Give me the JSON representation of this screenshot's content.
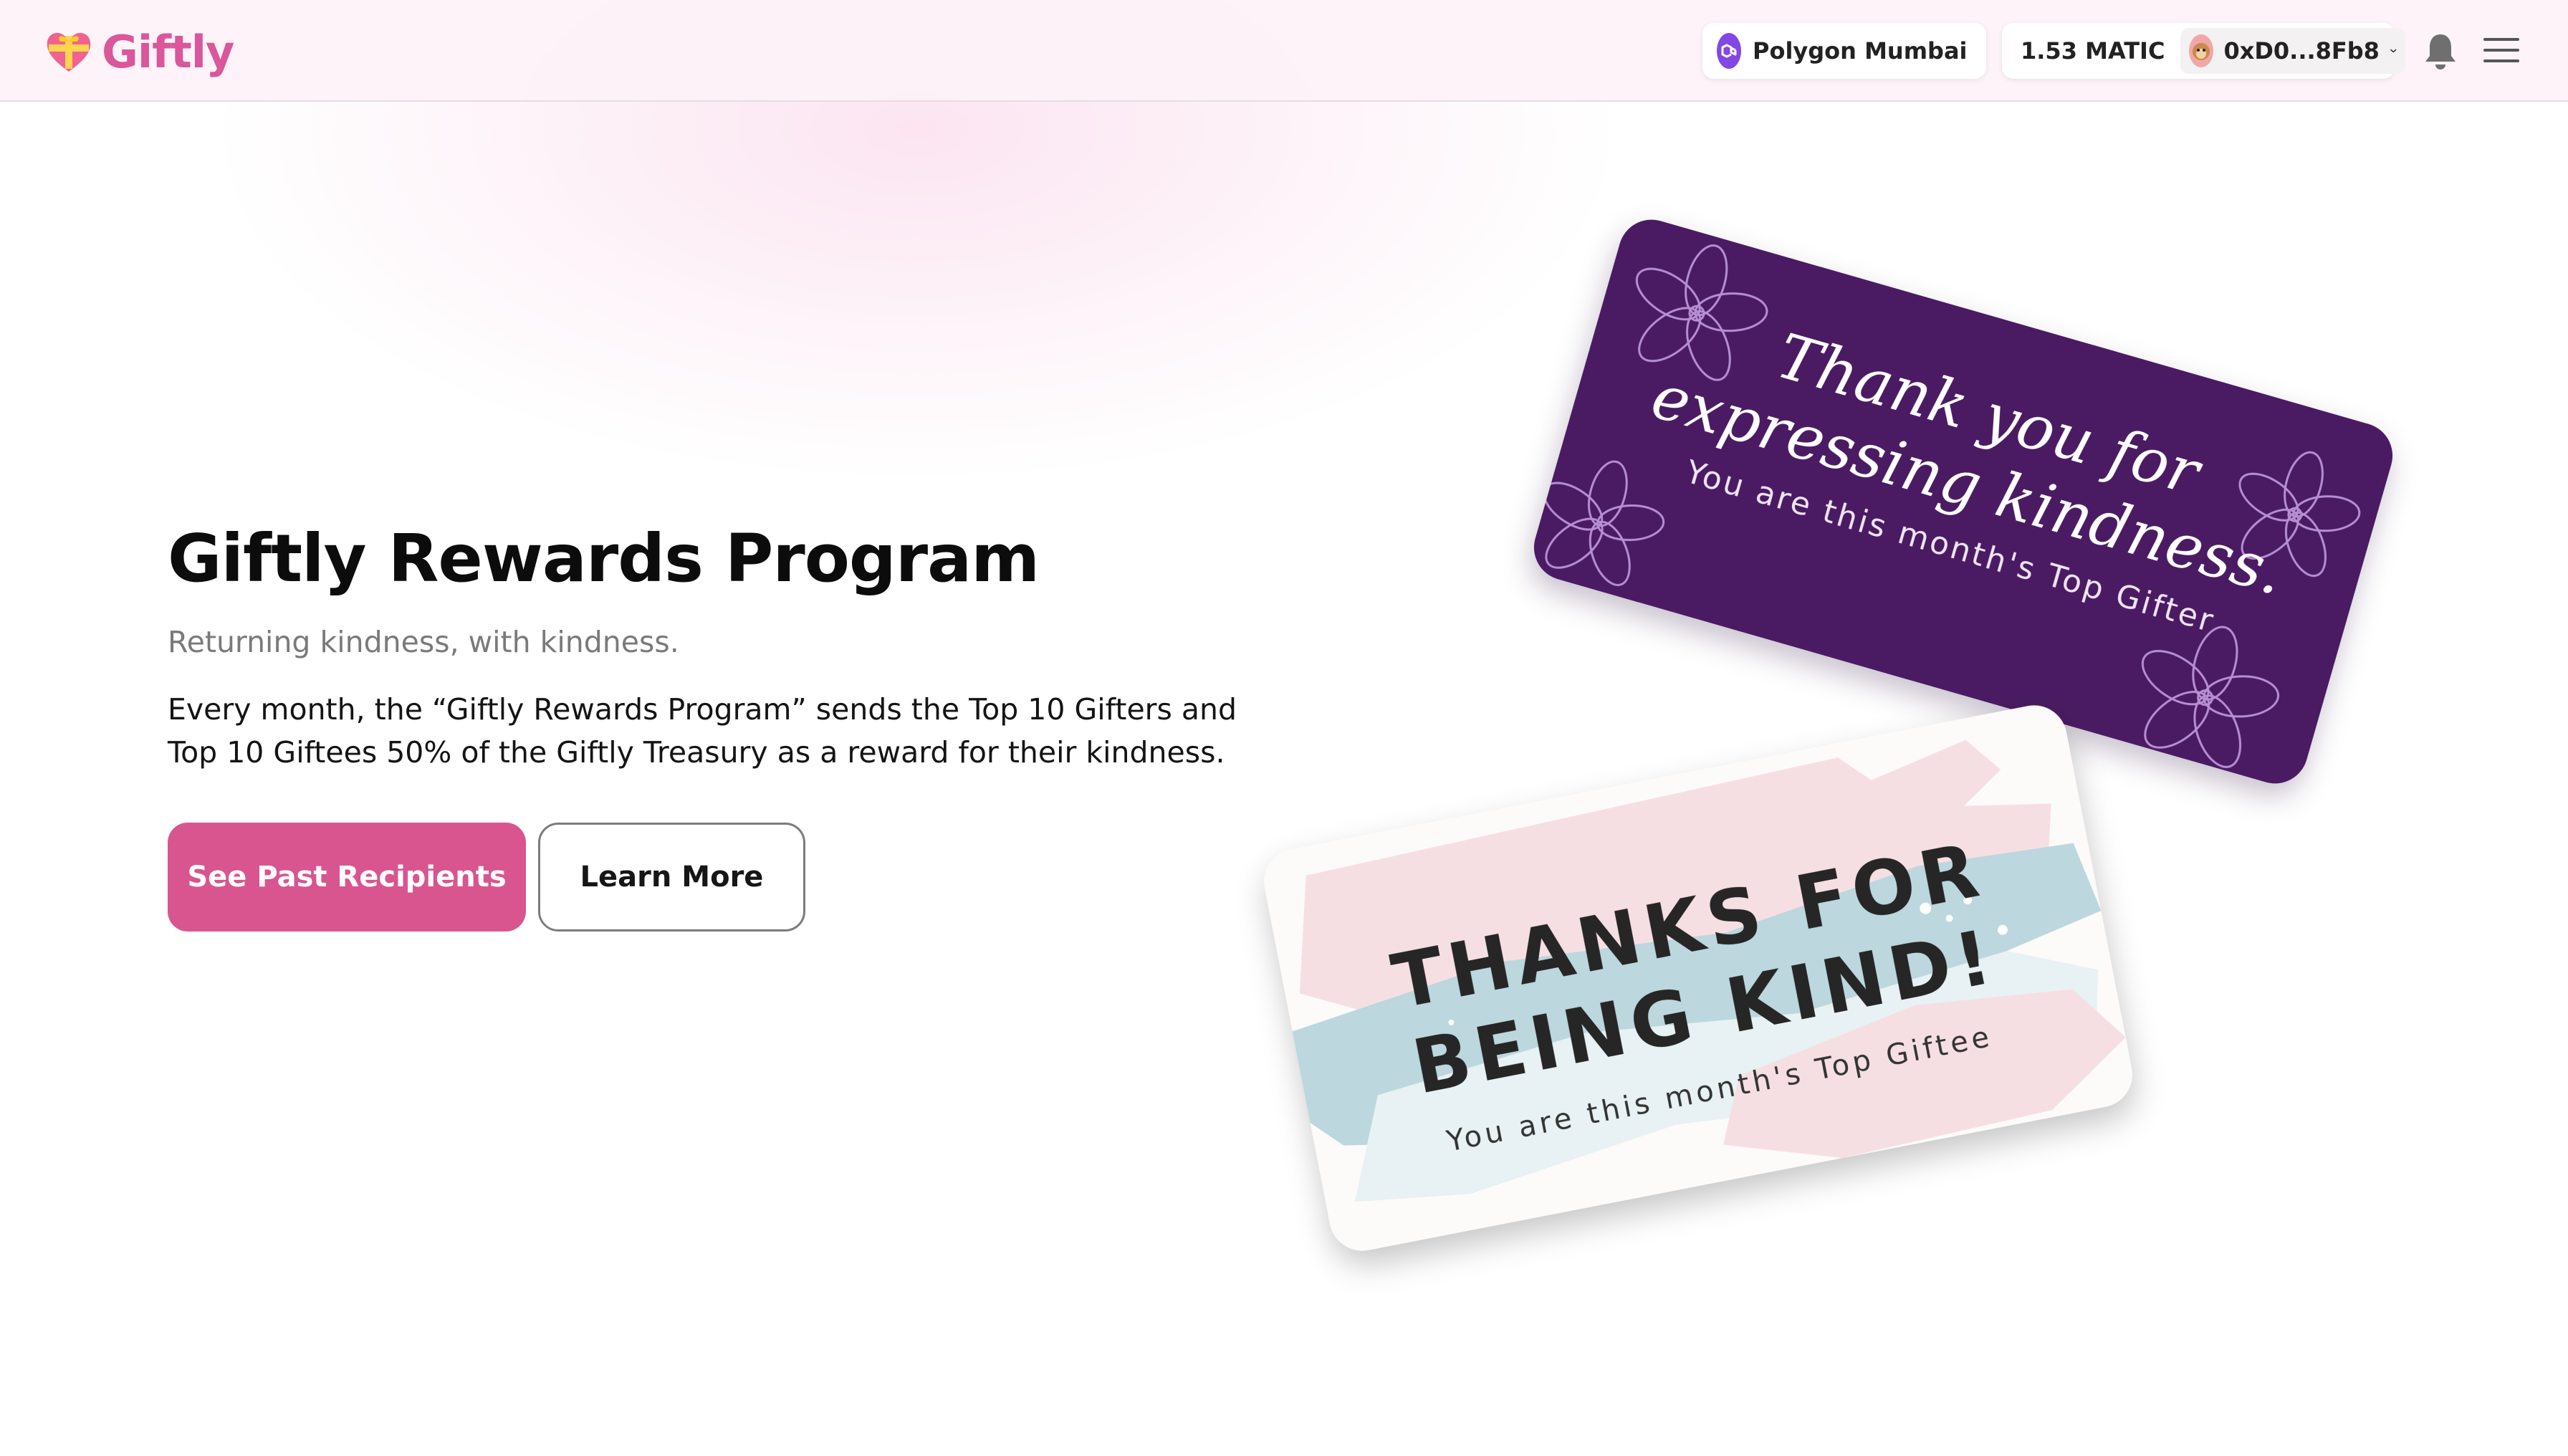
{
  "brand": {
    "name": "Giftly",
    "color": "#d9579a",
    "logo_icon": "heart-gift-icon"
  },
  "header": {
    "network": {
      "label": "Polygon Mumbai",
      "icon": "polygon-icon"
    },
    "account": {
      "balance": "1.53 MATIC",
      "address": "0xD0...8Fb8",
      "avatar": "monkey-avatar"
    },
    "icons": [
      "bell-icon",
      "hamburger-menu-icon"
    ]
  },
  "hero": {
    "title": "Giftly Rewards Program",
    "subtitle": "Returning kindness, with kindness.",
    "description": "Every month, the “Giftly Rewards Program” sends the Top 10 Gifters and Top 10 Giftees 50% of the Giftly Treasury as a reward for their kindness.",
    "primary_button": "See Past Recipients",
    "secondary_button": "Learn More"
  },
  "cards": {
    "gifter": {
      "line1": "Thank you for",
      "line2": "expressing kindness.",
      "subtitle": "You are this month's Top Gifter",
      "background": "#4a1b62"
    },
    "giftee": {
      "line1": "THANKS FOR",
      "line2": "BEING KIND!",
      "subtitle": "You are this month's Top Giftee",
      "accent_pink": "#f6dfe2",
      "accent_blue": "#bcd7dd"
    }
  },
  "colors": {
    "primary_button": "#d9558f"
  }
}
